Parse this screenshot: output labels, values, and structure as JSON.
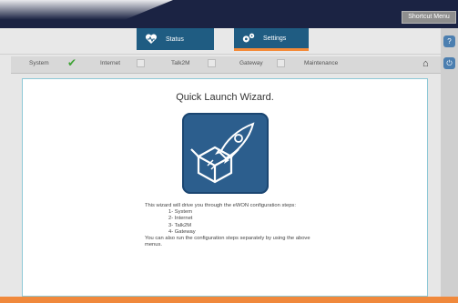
{
  "header": {
    "shortcut_label": "Shortcut Menu"
  },
  "tabs": [
    {
      "label": "Status",
      "icon": "heart-icon"
    },
    {
      "label": "Settings",
      "icon": "gears-icon"
    }
  ],
  "steps": [
    {
      "label": "System",
      "state": "done"
    },
    {
      "label": "Internet",
      "state": "unchecked"
    },
    {
      "label": "Talk2M",
      "state": "unchecked"
    },
    {
      "label": "Gateway",
      "state": "unchecked"
    },
    {
      "label": "Maintenance",
      "state": "none"
    }
  ],
  "wizard": {
    "title": "Quick Launch Wizard.",
    "intro": "This wizard will drive you through the eWON configuration steps:",
    "items": [
      "1- System",
      "2- Internet",
      "3- Talk2M",
      "4- Gateway"
    ],
    "outro": "You can also run the configuration steps separately by using the above menus."
  },
  "colors": {
    "navy": "#1b2343",
    "tab_blue": "#1f5c82",
    "accent_orange": "#f48a38",
    "check_green": "#3fa336"
  }
}
